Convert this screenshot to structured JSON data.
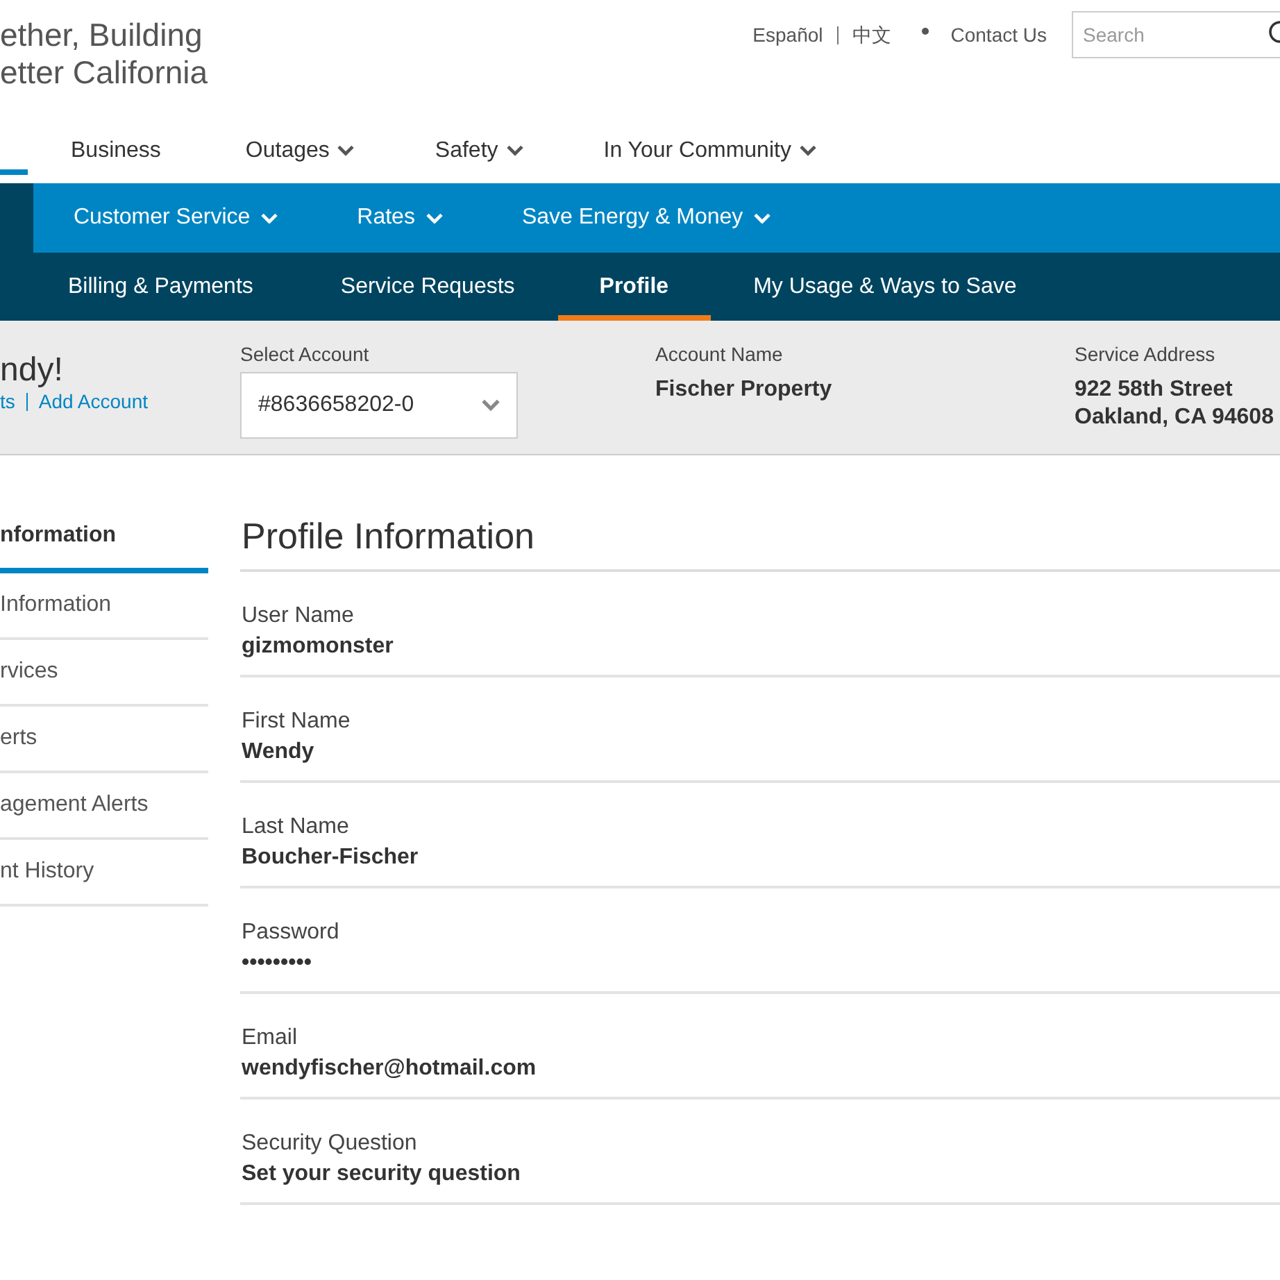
{
  "logo": {
    "lines": [
      "ether, Building",
      "etter California"
    ]
  },
  "utility_links": [
    {
      "label": "Español",
      "kind": "link"
    },
    {
      "label": "中文",
      "kind": "link"
    },
    {
      "label": "Contact Us",
      "kind": "link"
    }
  ],
  "search": {
    "placeholder": "Search"
  },
  "main_nav": [
    {
      "label": "Business",
      "dropdown": false
    },
    {
      "label": "Outages",
      "dropdown": true
    },
    {
      "label": "Safety",
      "dropdown": true
    },
    {
      "label": "In Your Community",
      "dropdown": true
    }
  ],
  "section_nav": [
    {
      "label": "Customer Service"
    },
    {
      "label": "Rates"
    },
    {
      "label": "Save Energy & Money"
    }
  ],
  "sub_nav": [
    {
      "label": "Billing & Payments",
      "selected": false
    },
    {
      "label": "Service Requests",
      "selected": false
    },
    {
      "label": "Profile",
      "selected": true
    },
    {
      "label": "My Usage & Ways to Save",
      "selected": false
    }
  ],
  "account_bar": {
    "greeting": "ndy!",
    "links": [
      "ts",
      "Add Account"
    ],
    "select_label": "Select Account",
    "select_value": "#8636658202-0",
    "name_label": "Account Name",
    "name_value": "Fischer Property",
    "address_label": "Service Address",
    "address_lines": [
      "922 58th Street",
      "Oakland, CA 94608"
    ]
  },
  "sidebar": {
    "items": [
      {
        "label": "nformation",
        "selected": true
      },
      {
        "label": "Information",
        "selected": false
      },
      {
        "label": "rvices",
        "selected": false
      },
      {
        "label": "erts",
        "selected": false
      },
      {
        "label": "agement Alerts",
        "selected": false
      },
      {
        "label": "nt History",
        "selected": false
      }
    ]
  },
  "profile": {
    "title": "Profile Information",
    "fields": [
      {
        "label": "User Name",
        "value": "gizmomonster"
      },
      {
        "label": "First Name",
        "value": "Wendy"
      },
      {
        "label": "Last Name",
        "value": "Boucher-Fischer"
      },
      {
        "label": "Password",
        "value": "•••••••••"
      },
      {
        "label": "Email",
        "value": "wendyfischer@hotmail.com"
      },
      {
        "label": "Security Question",
        "value": "Set your security question"
      }
    ]
  }
}
